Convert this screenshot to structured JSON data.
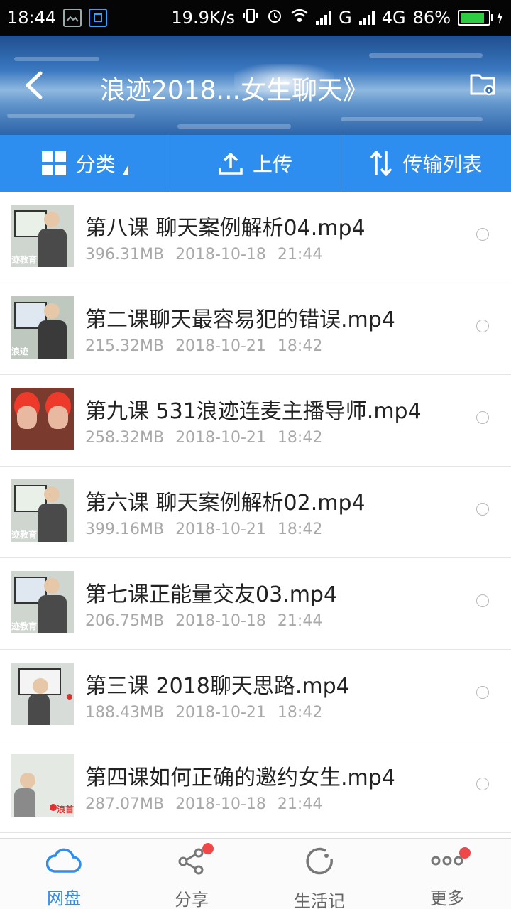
{
  "status_bar": {
    "time": "18:44",
    "speed": "19.9K/s",
    "network_g": "G",
    "network_4g": "4G",
    "battery_percent": "86%",
    "battery_level": 0.86
  },
  "header": {
    "title": "浪迹2018...女生聊天》",
    "back_icon": "chevron-left-icon",
    "folder_icon": "folder-settings-icon"
  },
  "toolbar": {
    "category_label": "分类",
    "upload_label": "上传",
    "transfer_label": "传输列表"
  },
  "files": [
    {
      "name": "第八课 聊天案例解析04.mp4",
      "size": "396.31MB",
      "date": "2018-10-18",
      "time": "21:44"
    },
    {
      "name": "第二课聊天最容易犯的错误.mp4",
      "size": "215.32MB",
      "date": "2018-10-21",
      "time": "18:42"
    },
    {
      "name": "第九课 531浪迹连麦主播导师.mp4",
      "size": "258.32MB",
      "date": "2018-10-21",
      "time": "18:42"
    },
    {
      "name": "第六课 聊天案例解析02.mp4",
      "size": "399.16MB",
      "date": "2018-10-21",
      "time": "18:42"
    },
    {
      "name": "第七课正能量交友03.mp4",
      "size": "206.75MB",
      "date": "2018-10-18",
      "time": "21:44"
    },
    {
      "name": "第三课 2018聊天思路.mp4",
      "size": "188.43MB",
      "date": "2018-10-21",
      "time": "18:42"
    },
    {
      "name": "第四课如何正确的邀约女生.mp4",
      "size": "287.07MB",
      "date": "2018-10-18",
      "time": "21:44"
    }
  ],
  "bottom_nav": {
    "items": [
      {
        "label": "网盘",
        "icon": "cloud-icon",
        "active": true,
        "badge": false
      },
      {
        "label": "分享",
        "icon": "share-icon",
        "active": false,
        "badge": true
      },
      {
        "label": "生活记",
        "icon": "refresh-icon",
        "active": false,
        "badge": false
      },
      {
        "label": "更多",
        "icon": "more-icon",
        "active": false,
        "badge": true
      }
    ]
  },
  "colors": {
    "accent": "#2e8ef0",
    "badge": "#f04848",
    "battery": "#2ecc40"
  }
}
